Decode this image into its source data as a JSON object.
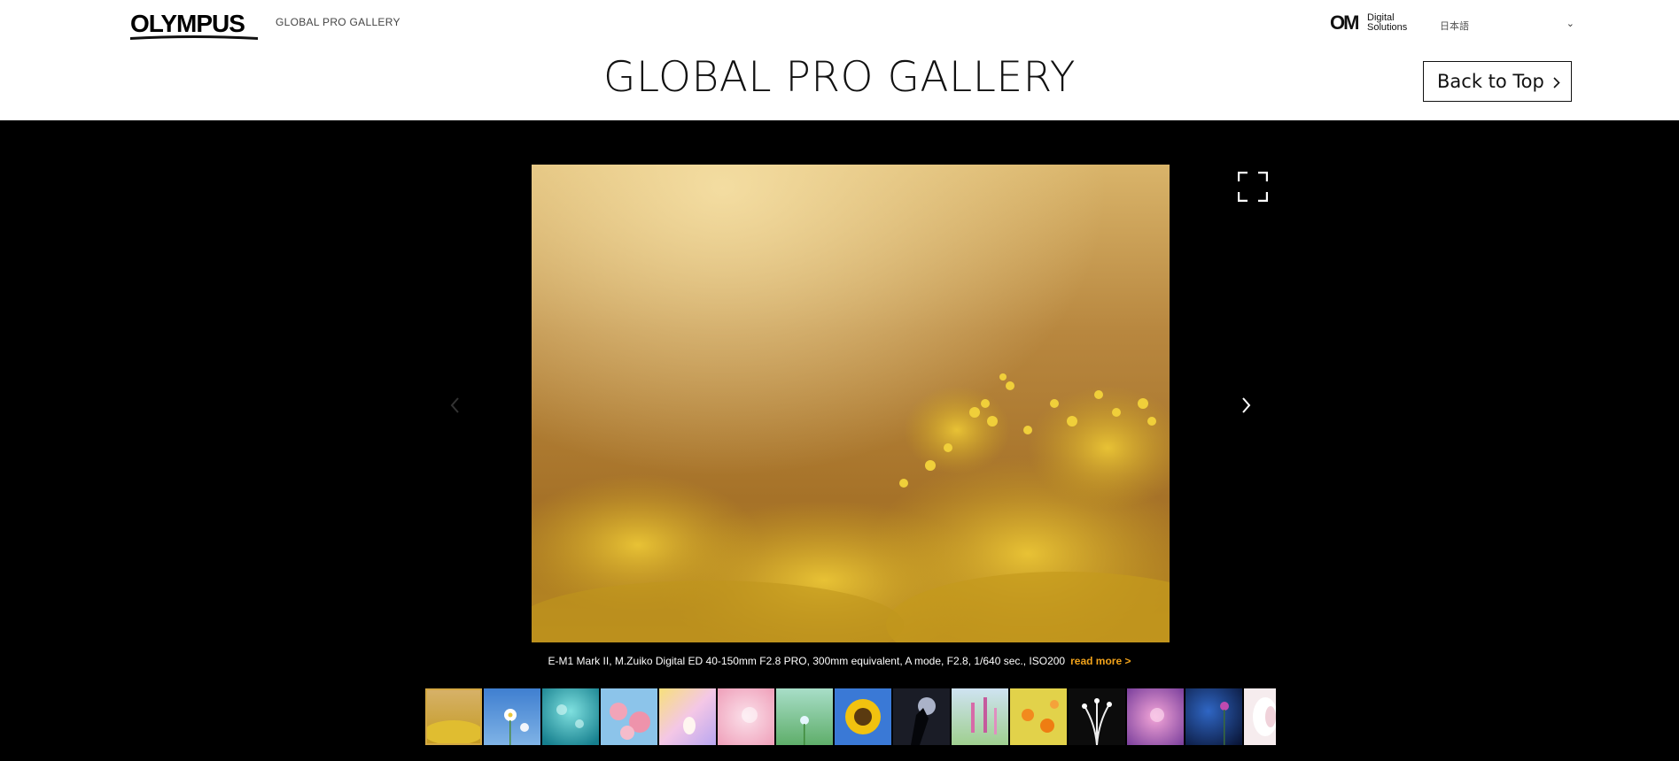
{
  "header": {
    "brand": "OLYMPUS",
    "site_label": "GLOBAL PRO GALLERY",
    "om_mark": "OM",
    "om_line1": "Digital",
    "om_line2": "Solutions",
    "lang_label": "日本語",
    "page_title": "GLOBAL PRO GALLERY",
    "back_to_top": "Back to Top"
  },
  "viewer": {
    "caption": "E-M1 Mark II, M.Zuiko Digital ED 40-150mm F2.8 PRO, 300mm equivalent, A mode, F2.8, 1/640 sec., ISO200",
    "read_more": "read more >",
    "thumbnails": [
      {
        "name": "thumb-yellow-flowers",
        "active": true
      },
      {
        "name": "thumb-white-daisies"
      },
      {
        "name": "thumb-teal-bokeh"
      },
      {
        "name": "thumb-pink-blossoms"
      },
      {
        "name": "thumb-pastel-flower"
      },
      {
        "name": "thumb-pink-petals"
      },
      {
        "name": "thumb-green-meadow"
      },
      {
        "name": "thumb-sunflower"
      },
      {
        "name": "thumb-dark-silhouette"
      },
      {
        "name": "thumb-pink-wildflowers"
      },
      {
        "name": "thumb-orange-field"
      },
      {
        "name": "thumb-white-stamen"
      },
      {
        "name": "thumb-purple-bokeh"
      },
      {
        "name": "thumb-blue-night-flower"
      },
      {
        "name": "thumb-white-petal"
      }
    ]
  },
  "colors": {
    "accent": "#f0a21b",
    "header_bg": "#ffffff",
    "viewer_bg": "#000000"
  }
}
